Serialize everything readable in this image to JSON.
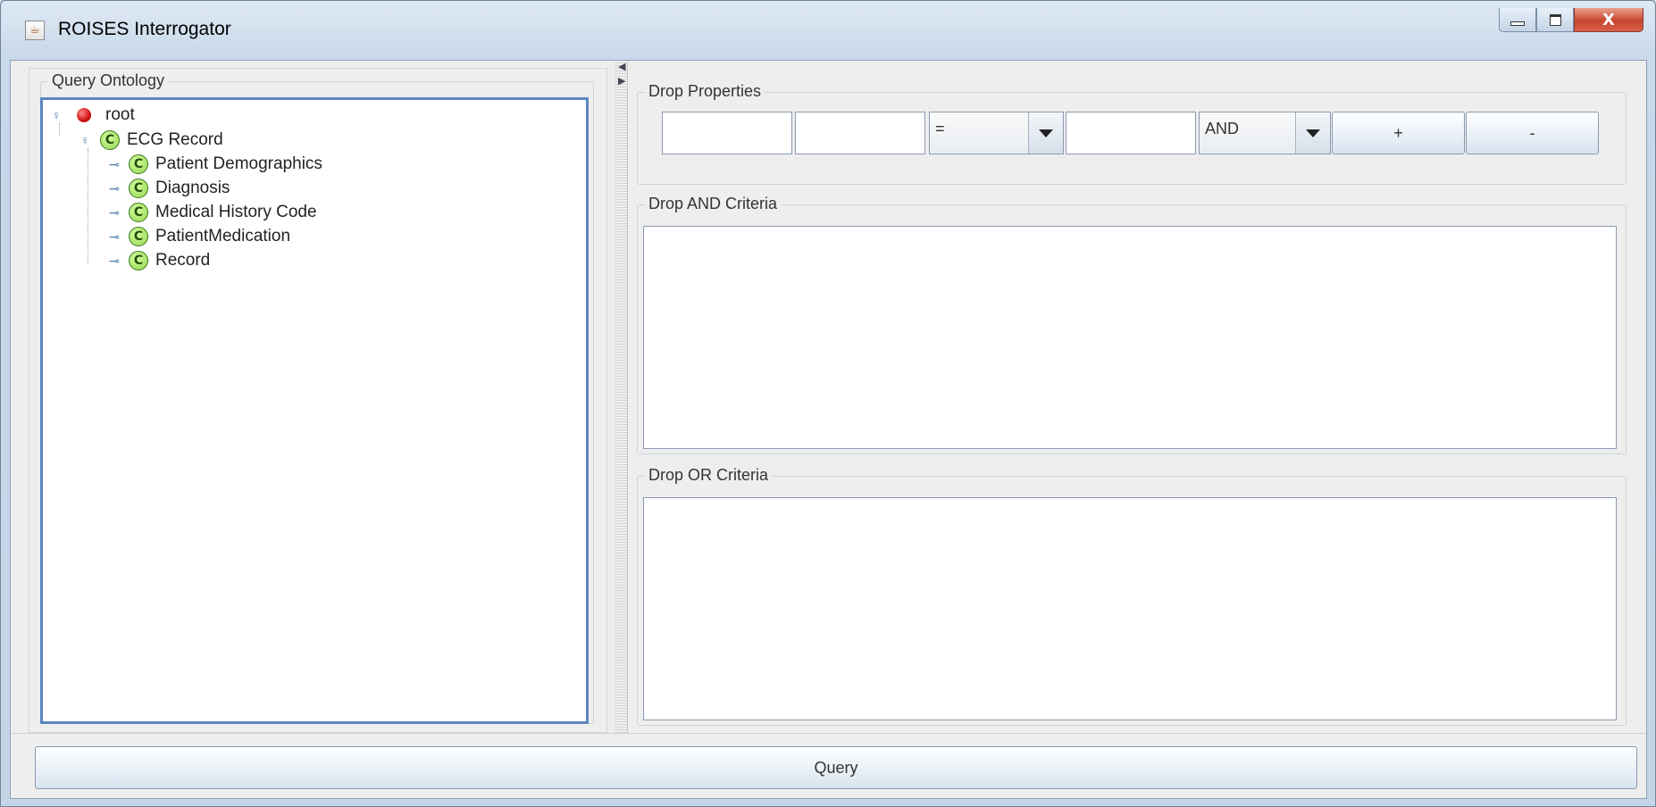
{
  "window": {
    "title": "ROISES Interrogator",
    "controls": {
      "minimize": "minimize-icon",
      "maximize": "maximize-icon",
      "close": "X"
    }
  },
  "ontology": {
    "group_title": "Query Ontology",
    "root": "root",
    "nodes": [
      {
        "label": "ECG Record",
        "icon": "C",
        "level": 1
      },
      {
        "label": "Patient Demographics",
        "icon": "C",
        "level": 2
      },
      {
        "label": "Diagnosis",
        "icon": "C",
        "level": 2
      },
      {
        "label": "Medical History Code",
        "icon": "C",
        "level": 2
      },
      {
        "label": "PatientMedication",
        "icon": "C",
        "level": 2
      },
      {
        "label": "Record",
        "icon": "C",
        "level": 2
      }
    ]
  },
  "properties": {
    "group_title": "Drop Properties",
    "field1_value": "",
    "field2_value": "",
    "operator_selected": "=",
    "value_field": "",
    "logic_selected": "AND",
    "add_label": "+",
    "remove_label": "-"
  },
  "and_criteria": {
    "group_title": "Drop AND Criteria"
  },
  "or_criteria": {
    "group_title": "Drop OR Criteria"
  },
  "query_button": "Query",
  "colors": {
    "tree_border": "#5b86bf",
    "class_icon": "#8fd34e",
    "root_icon": "#d01010",
    "close_button": "#c8452d"
  }
}
